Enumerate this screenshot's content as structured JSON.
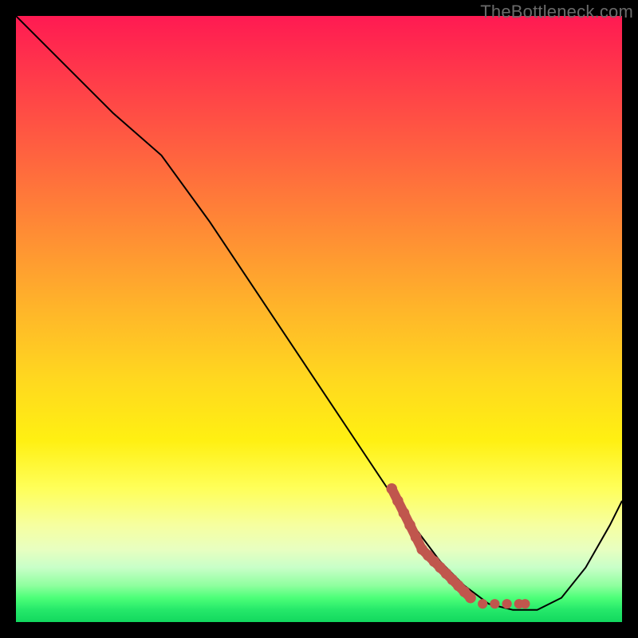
{
  "attribution": "TheBottleneck.com",
  "chart_data": {
    "type": "line",
    "title": "",
    "xlabel": "",
    "ylabel": "",
    "xlim": [
      0,
      100
    ],
    "ylim": [
      0,
      100
    ],
    "grid": false,
    "legend": false,
    "series": [
      {
        "name": "curve",
        "color": "#000000",
        "x": [
          0,
          8,
          16,
          24,
          32,
          40,
          48,
          56,
          64,
          70,
          74,
          78,
          82,
          86,
          90,
          94,
          98,
          100
        ],
        "y": [
          100,
          92,
          84,
          77,
          66,
          54,
          42,
          30,
          18,
          10,
          6,
          3,
          2,
          2,
          4,
          9,
          16,
          20
        ]
      },
      {
        "name": "marker-band",
        "color": "#c0564d",
        "type": "scatter",
        "x": [
          62,
          63,
          64,
          65,
          66,
          67,
          68,
          69,
          70,
          71,
          72,
          73,
          74,
          75,
          77,
          79,
          81,
          83,
          84
        ],
        "y": [
          22,
          20,
          18,
          16,
          14,
          12,
          11,
          10,
          9,
          8,
          7,
          6,
          5,
          4,
          3,
          3,
          3,
          3,
          3
        ]
      }
    ],
    "background_gradient": {
      "direction": "vertical",
      "stops": [
        {
          "pos": 0.0,
          "color": "#ff1a52"
        },
        {
          "pos": 0.1,
          "color": "#ff3a4a"
        },
        {
          "pos": 0.22,
          "color": "#ff6040"
        },
        {
          "pos": 0.35,
          "color": "#ff8a35"
        },
        {
          "pos": 0.48,
          "color": "#ffb42a"
        },
        {
          "pos": 0.6,
          "color": "#ffd81f"
        },
        {
          "pos": 0.7,
          "color": "#fff012"
        },
        {
          "pos": 0.78,
          "color": "#ffff5a"
        },
        {
          "pos": 0.84,
          "color": "#f6ffa0"
        },
        {
          "pos": 0.88,
          "color": "#e8ffc0"
        },
        {
          "pos": 0.91,
          "color": "#c8ffc8"
        },
        {
          "pos": 0.94,
          "color": "#8eff9e"
        },
        {
          "pos": 0.96,
          "color": "#4cff78"
        },
        {
          "pos": 0.98,
          "color": "#25e86a"
        },
        {
          "pos": 1.0,
          "color": "#12d85e"
        }
      ]
    }
  }
}
